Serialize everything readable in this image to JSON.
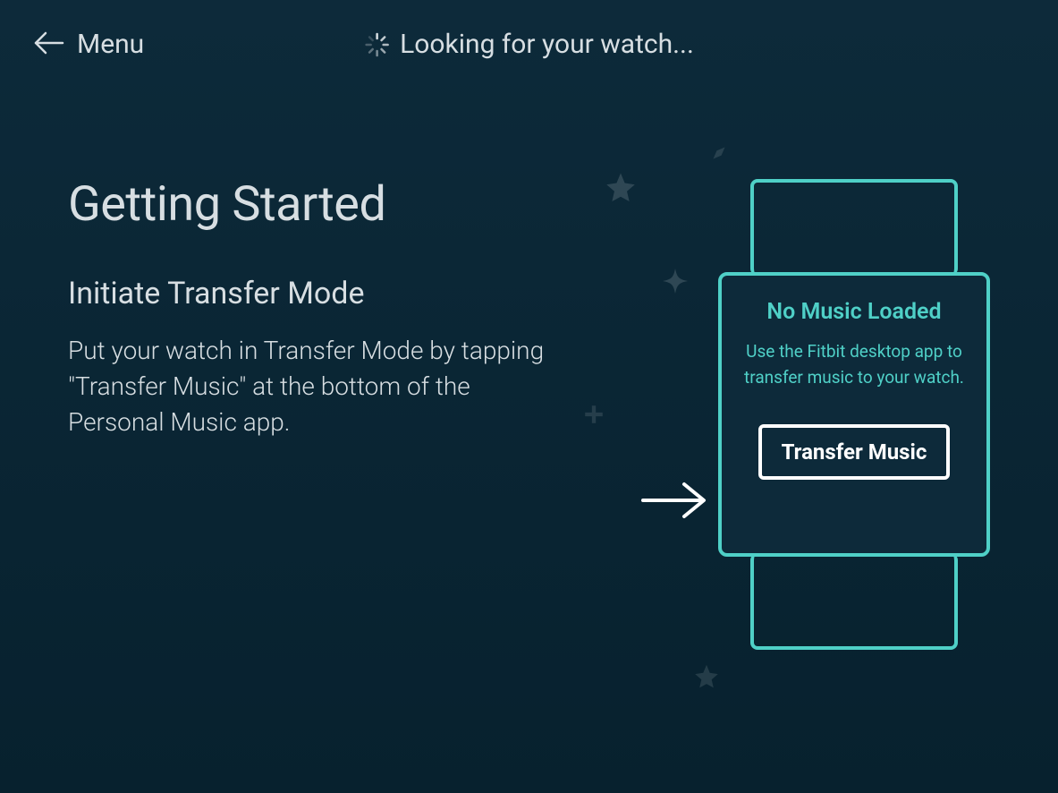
{
  "header": {
    "menu_label": "Menu",
    "status_text": "Looking for your watch..."
  },
  "main": {
    "title": "Getting Started",
    "subtitle": "Initiate Transfer Mode",
    "body": "Put your watch in Transfer Mode by tapping \"Transfer Music\" at the bottom of the Personal Music app."
  },
  "watch": {
    "title": "No Music Loaded",
    "desc": "Use the Fitbit desktop app to transfer music to your watch.",
    "button_label": "Transfer Music"
  },
  "colors": {
    "accent": "#4fd0c7",
    "text": "#d7dee2",
    "bg_top": "#0d2a3a",
    "bg_bottom": "#07212e"
  }
}
